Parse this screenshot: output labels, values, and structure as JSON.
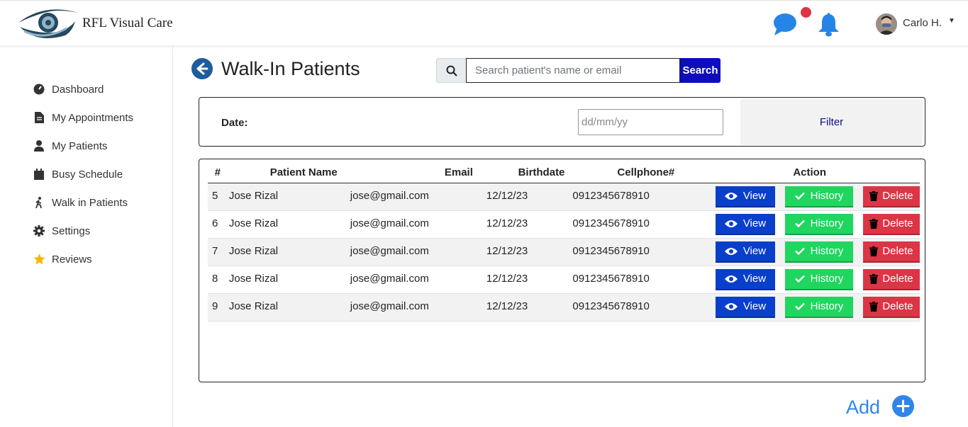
{
  "header": {
    "brand": "RFL Visual Care",
    "user_name": "Carlo H.",
    "icons": [
      "eye-hand-logo",
      "chat-icon",
      "bell-icon",
      "avatar",
      "caret-down-icon"
    ],
    "notification_dot_color": "#dc3545"
  },
  "sidebar": {
    "items": [
      {
        "label": "Dashboard",
        "icon": "gauge-icon"
      },
      {
        "label": "My Appointments",
        "icon": "file-icon"
      },
      {
        "label": "My Patients",
        "icon": "user-icon"
      },
      {
        "label": "Busy Schedule",
        "icon": "calendar-icon"
      },
      {
        "label": "Walk in Patients",
        "icon": "walking-icon"
      },
      {
        "label": "Settings",
        "icon": "gear-icon"
      },
      {
        "label": "Reviews",
        "icon": "star-icon"
      }
    ]
  },
  "main": {
    "title": "Walk-In Patients",
    "search": {
      "placeholder": "Search patient's name or email",
      "value": "",
      "button_label": "Search"
    },
    "filter": {
      "date_label": "Date:",
      "date_placeholder": "dd/mm/yy",
      "button_label": "Filter"
    },
    "table": {
      "columns": [
        "#",
        "Patient Name",
        "Email",
        "Birthdate",
        "Cellphone#",
        "Action"
      ],
      "rows": [
        {
          "num": "5",
          "name": "Jose Rizal",
          "email": "jose@gmail.com",
          "birthdate": "12/12/23",
          "cellphone": "0912345678910"
        },
        {
          "num": "6",
          "name": "Jose Rizal",
          "email": "jose@gmail.com",
          "birthdate": "12/12/23",
          "cellphone": "0912345678910"
        },
        {
          "num": "7",
          "name": "Jose Rizal",
          "email": "jose@gmail.com",
          "birthdate": "12/12/23",
          "cellphone": "0912345678910"
        },
        {
          "num": "8",
          "name": "Jose Rizal",
          "email": "jose@gmail.com",
          "birthdate": "12/12/23",
          "cellphone": "0912345678910"
        },
        {
          "num": "9",
          "name": "Jose Rizal",
          "email": "jose@gmail.com",
          "birthdate": "12/12/23",
          "cellphone": "0912345678910"
        }
      ],
      "actions": {
        "view": "View",
        "history": "History",
        "delete": "Delete"
      }
    },
    "add_label": "Add"
  },
  "colors": {
    "view": "#0a3fcc",
    "history": "#1fd65f",
    "delete": "#dc3545",
    "search_button": "#0d0dbd",
    "accent": "#2f86e8"
  }
}
